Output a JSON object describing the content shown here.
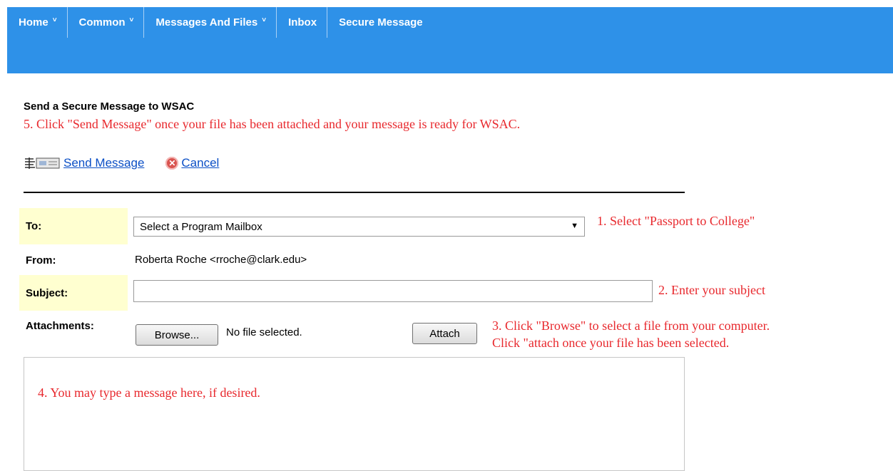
{
  "nav": {
    "items": [
      {
        "label": "Home",
        "chevron": "˅"
      },
      {
        "label": "Common",
        "chevron": "˅"
      },
      {
        "label": "Messages And Files",
        "chevron": "˅"
      },
      {
        "label": "Inbox",
        "chevron": ""
      },
      {
        "label": "Secure Message",
        "chevron": ""
      }
    ]
  },
  "page": {
    "title": "Send a Secure Message to WSAC",
    "instruction_5": "5.  Click \"Send Message\" once your file has been attached and your message is ready for WSAC."
  },
  "actions": {
    "send_label": "Send Message",
    "cancel_label": "Cancel"
  },
  "form": {
    "to_label": "To:",
    "to_selected": "Select a Program Mailbox",
    "from_label": "From:",
    "from_value": "Roberta Roche <rroche@clark.edu>",
    "subject_label": "Subject:",
    "subject_value": "",
    "attachments_label": "Attachments:",
    "browse_label": "Browse...",
    "file_status": "No file selected.",
    "attach_label": "Attach"
  },
  "hints": {
    "h1": "1.  Select \"Passport to College\"",
    "h2": "2.  Enter your subject",
    "h3a": "3.  Click \"Browse\" to select a file from your computer.",
    "h3b": "Click \"attach once your file has been selected.",
    "h4": "4.  You may type a message here, if desired."
  },
  "colors": {
    "nav_bg": "#2e91e8",
    "highlight": "#ffffd0",
    "hint_red": "#e8282d",
    "link_blue": "#0b4fc6"
  },
  "icons": {
    "send": "send-message-icon",
    "cancel": "cancel-icon",
    "dropdown": "chevron-down-icon"
  }
}
